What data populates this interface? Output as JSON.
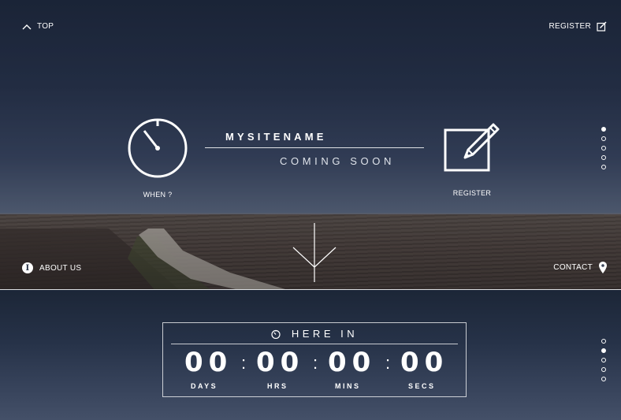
{
  "nav": {
    "top_label": "TOP",
    "register_label": "REGISTER",
    "about_label": "ABOUT US",
    "contact_label": "CONTACT",
    "about_icon_glyph": "i"
  },
  "hero": {
    "site_name": "MYSITENAME",
    "tagline": "COMING SOON",
    "when_label": "WHEN ?",
    "register_label": "REGISTER",
    "icons": [
      "chevron-up-icon",
      "edit-icon",
      "stopwatch-icon",
      "info-icon",
      "location-pin-icon",
      "arrow-down-icon"
    ]
  },
  "countdown": {
    "heading": "HERE IN",
    "days": "00",
    "hours": "00",
    "minutes": "00",
    "seconds": "00",
    "separator": ":",
    "labels": {
      "days": "DAYS",
      "hours": "HRS",
      "minutes": "MINS",
      "seconds": "SECS"
    }
  },
  "pagination": {
    "hero_active_index": 0,
    "countdown_active_index": 1,
    "count": 5
  },
  "colors": {
    "text": "#ffffff",
    "sky_top": "#1d283b",
    "field": "#4d4139"
  }
}
